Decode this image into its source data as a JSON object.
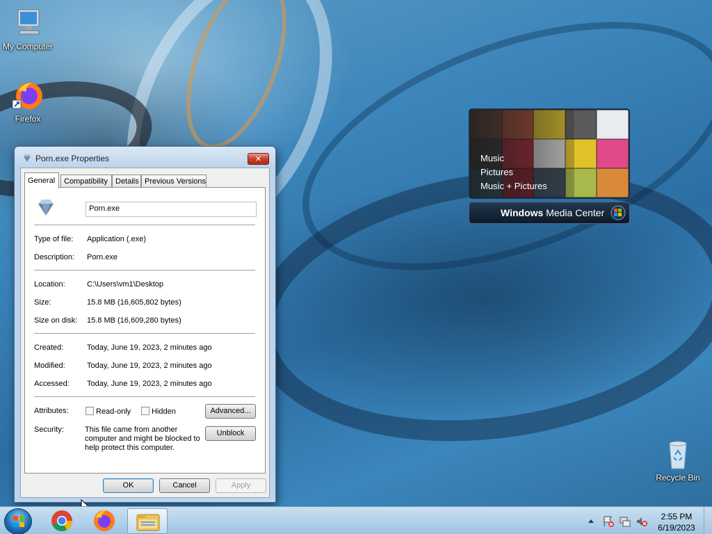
{
  "desktop": {
    "icons": [
      {
        "label": "My Computer"
      },
      {
        "label": "Firefox"
      },
      {
        "label": "Recycle Bin"
      }
    ]
  },
  "media_center": {
    "menu": [
      "Music",
      "Pictures",
      "Music + Pictures"
    ],
    "brand_bold": "Windows",
    "brand_rest": " Media Center"
  },
  "dialog": {
    "title": "Porn.exe Properties",
    "close_glyph": "✕",
    "tabs": [
      "General",
      "Compatibility",
      "Details",
      "Previous Versions"
    ],
    "active_tab": "General",
    "file_name": "Porn.exe",
    "type_label": "Type of file:",
    "type_value": "Application (.exe)",
    "description_label": "Description:",
    "description_value": "Porn.exe",
    "location_label": "Location:",
    "location_value": "C:\\Users\\vm1\\Desktop",
    "size_label": "Size:",
    "size_value": "15.8 MB (16,605,802 bytes)",
    "size_on_disk_label": "Size on disk:",
    "size_on_disk_value": "15.8 MB (16,609,280 bytes)",
    "created_label": "Created:",
    "created_value": "Today, June 19, 2023, 2 minutes ago",
    "modified_label": "Modified:",
    "modified_value": "Today, June 19, 2023, 2 minutes ago",
    "accessed_label": "Accessed:",
    "accessed_value": "Today, June 19, 2023, 2 minutes ago",
    "attributes_label": "Attributes:",
    "readonly_label": "Read-only",
    "hidden_label": "Hidden",
    "readonly_checked": false,
    "hidden_checked": false,
    "advanced_button": "Advanced...",
    "security_label": "Security:",
    "security_text_1": "This file came from another",
    "security_text_2": "computer and might be blocked to",
    "security_text_3": "help protect this computer.",
    "unblock_button": "Unblock",
    "ok_button": "OK",
    "cancel_button": "Cancel",
    "apply_button": "Apply"
  },
  "taskbar": {
    "pinned": [
      "Google Chrome",
      "Firefox",
      "Windows Explorer"
    ],
    "time": "2:55 PM",
    "date": "6/19/2023"
  },
  "colors": {
    "accent": "#3c7fb1",
    "close_red": "#c5402c",
    "taskbar": "#a5c8e4"
  }
}
